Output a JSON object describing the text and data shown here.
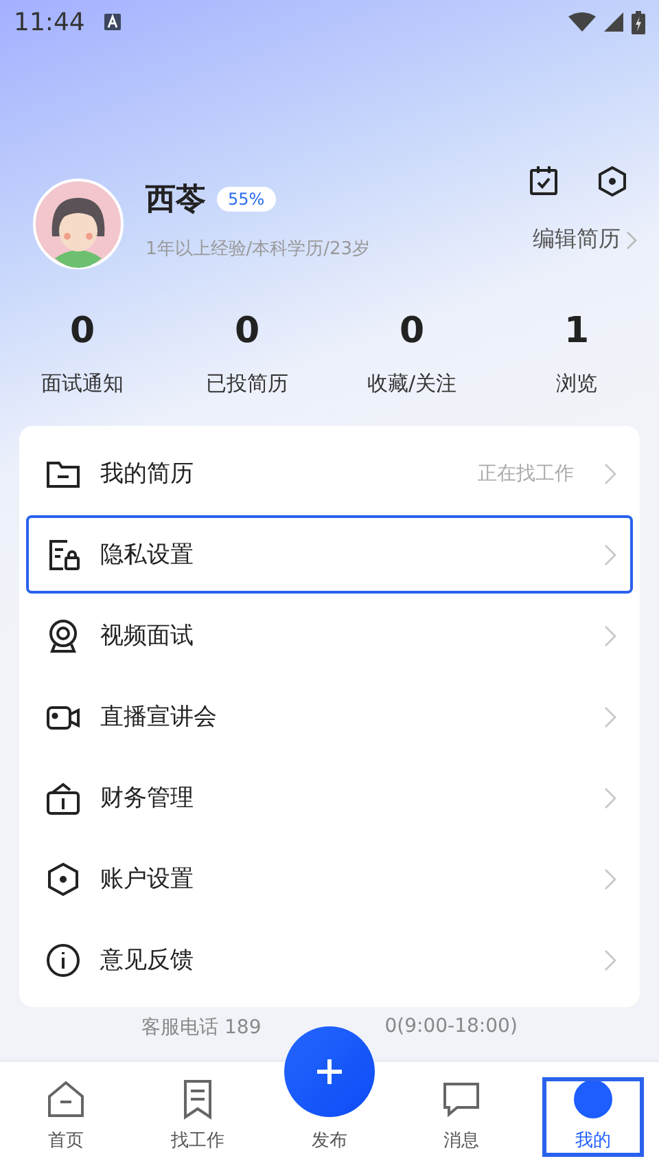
{
  "status_bar": {
    "time": "11:44"
  },
  "profile": {
    "name": "西苓",
    "completion": "55%",
    "details": "1年以上经验/本科学历/23岁",
    "edit_link": "编辑简历"
  },
  "stats": [
    {
      "value": "0",
      "label": "面试通知"
    },
    {
      "value": "0",
      "label": "已投简历"
    },
    {
      "value": "0",
      "label": "收藏/关注"
    },
    {
      "value": "1",
      "label": "浏览"
    }
  ],
  "menu": [
    {
      "label": "我的简历",
      "status": "正在找工作",
      "selected": false
    },
    {
      "label": "隐私设置",
      "selected": true
    },
    {
      "label": "视频面试",
      "selected": false
    },
    {
      "label": "直播宣讲会",
      "selected": false
    },
    {
      "label": "财务管理",
      "selected": false
    },
    {
      "label": "账户设置",
      "selected": false
    },
    {
      "label": "意见反馈",
      "selected": false
    }
  ],
  "footer": {
    "left": "客服电话 189",
    "right": "0(9:00-18:00)"
  },
  "nav": [
    {
      "label": "首页",
      "selected": false
    },
    {
      "label": "找工作",
      "selected": false
    },
    {
      "label": "发布",
      "selected": false
    },
    {
      "label": "消息",
      "selected": false
    },
    {
      "label": "我的",
      "selected": true
    }
  ]
}
